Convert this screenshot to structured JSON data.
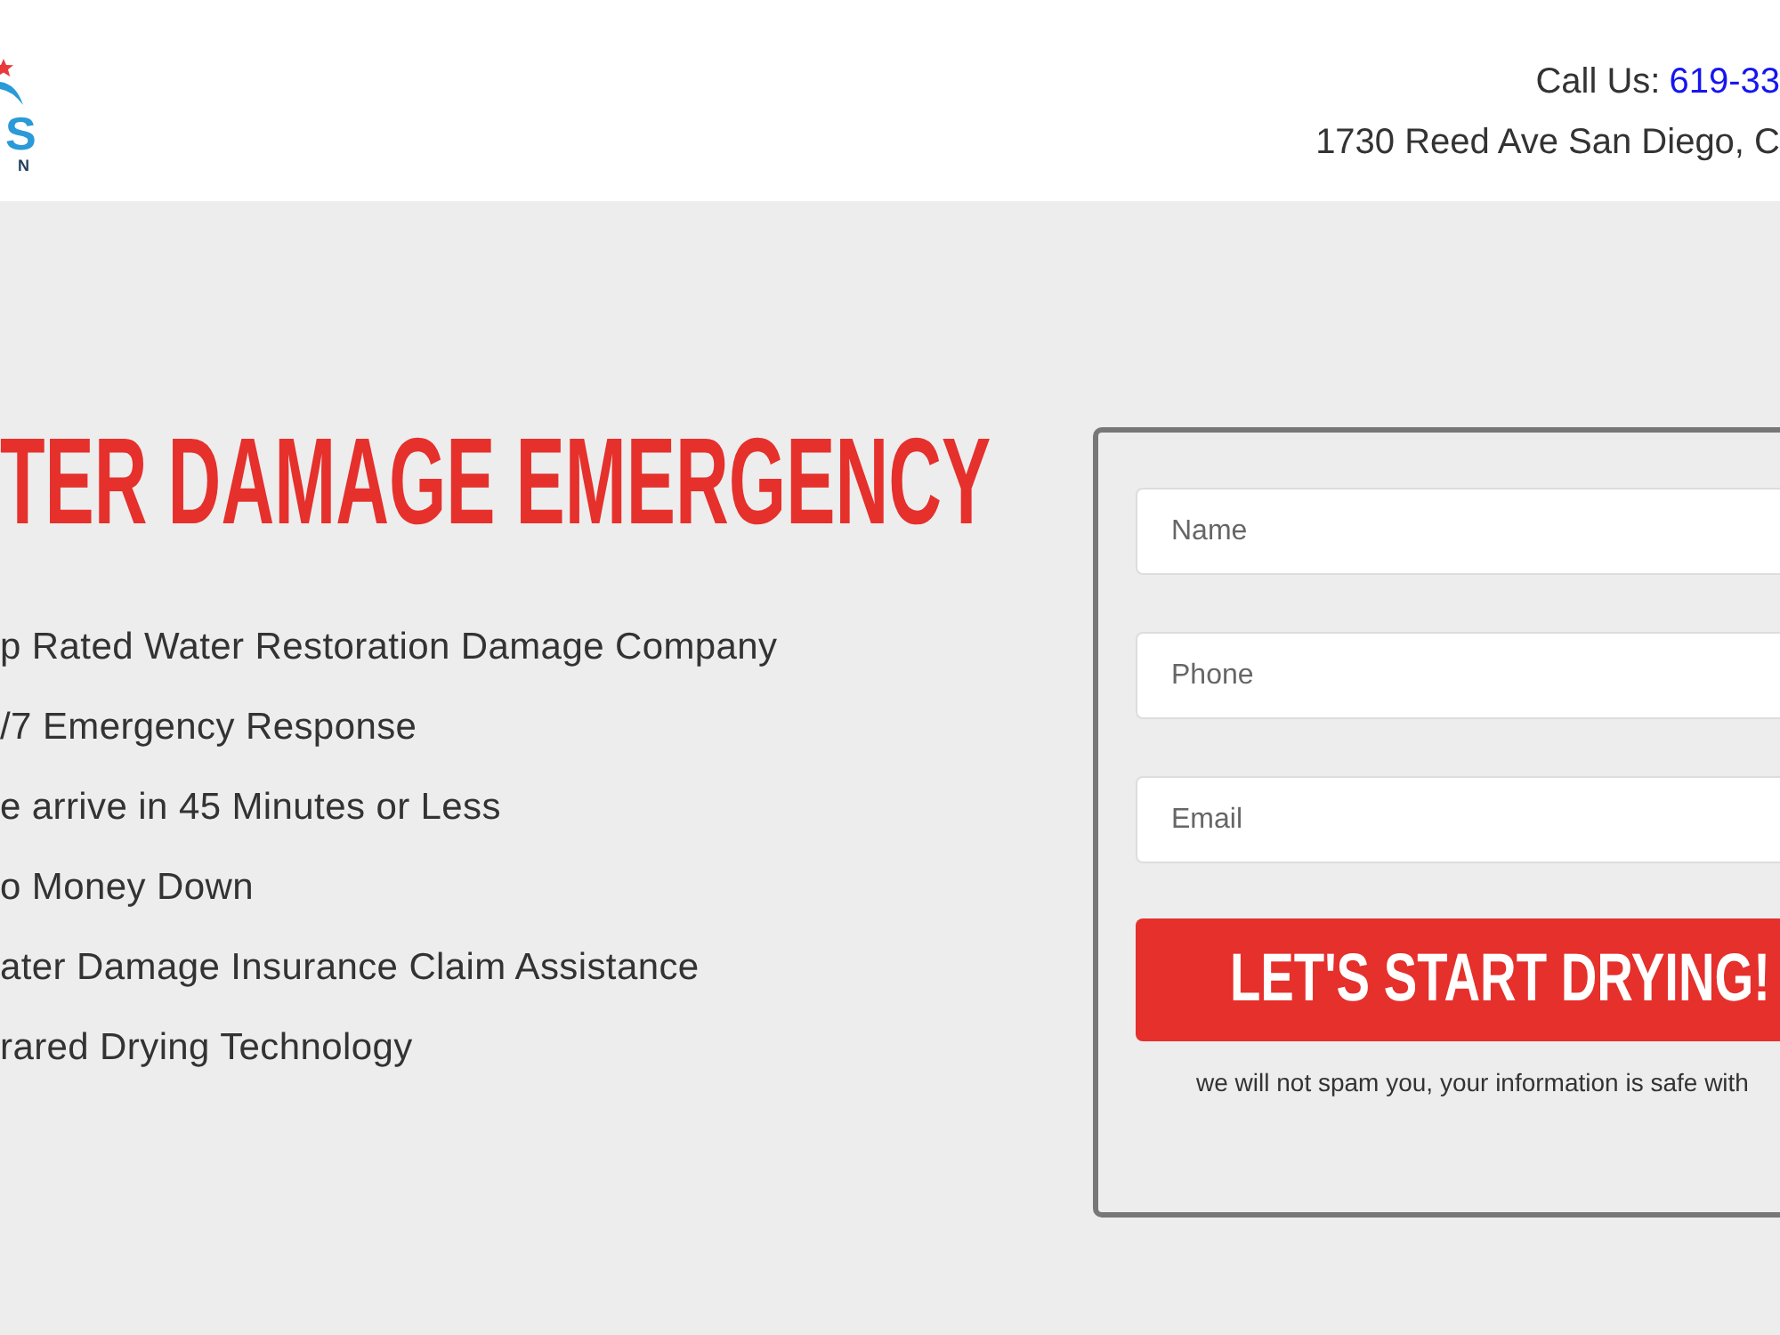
{
  "header": {
    "logo": {
      "wordmark": "S",
      "tagline": "N"
    },
    "call_label": "Call Us:",
    "phone": "619-33",
    "address": "1730 Reed Ave San Diego, C"
  },
  "hero": {
    "heading": "TER DAMAGE EMERGENCY",
    "features": [
      "p Rated Water Restoration Damage Company",
      "/7 Emergency Response",
      "e arrive in 45 Minutes or Less",
      "o Money Down",
      "ater Damage Insurance Claim Assistance",
      "rared Drying Technology"
    ]
  },
  "form": {
    "fields": [
      {
        "placeholder": "Name"
      },
      {
        "placeholder": "Phone"
      },
      {
        "placeholder": "Email"
      }
    ],
    "submit": "LET'S START DRYING!",
    "note": "we will not spam you, your information is safe with"
  }
}
